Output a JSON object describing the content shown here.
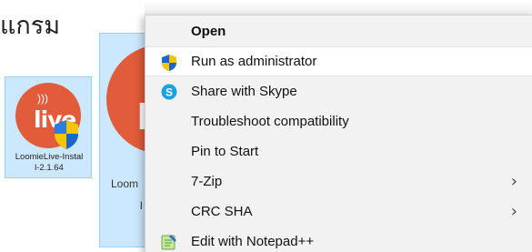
{
  "heading": "แกรม",
  "desktop": {
    "small_icon": {
      "caption_line1": "LoomieLive-Instal",
      "caption_line2": "l-2.1.64",
      "logo_text": "live"
    },
    "large_icon": {
      "caption_line1": "Loom",
      "caption_line2": "l",
      "logo_text": "l"
    }
  },
  "context_menu": {
    "items": [
      {
        "label": "Open",
        "bold": true,
        "icon": "none"
      },
      {
        "label": "Run as administrator",
        "icon": "uac-shield-icon",
        "highlighted": true
      },
      {
        "label": "Share with Skype",
        "icon": "skype-icon"
      },
      {
        "label": "Troubleshoot compatibility",
        "icon": "none"
      },
      {
        "label": "Pin to Start",
        "icon": "none"
      },
      {
        "label": "7-Zip",
        "icon": "none",
        "submenu_arrow": "›"
      },
      {
        "label": "CRC SHA",
        "icon": "none",
        "submenu_arrow": "›"
      },
      {
        "label": "Edit with Notepad++",
        "icon": "notepadpp-icon"
      }
    ]
  },
  "colors": {
    "selection": "#cce8ff",
    "logo_orange": "#e25b3a",
    "menu_bg": "#f2f2f2",
    "highlight": "#ffffff"
  }
}
